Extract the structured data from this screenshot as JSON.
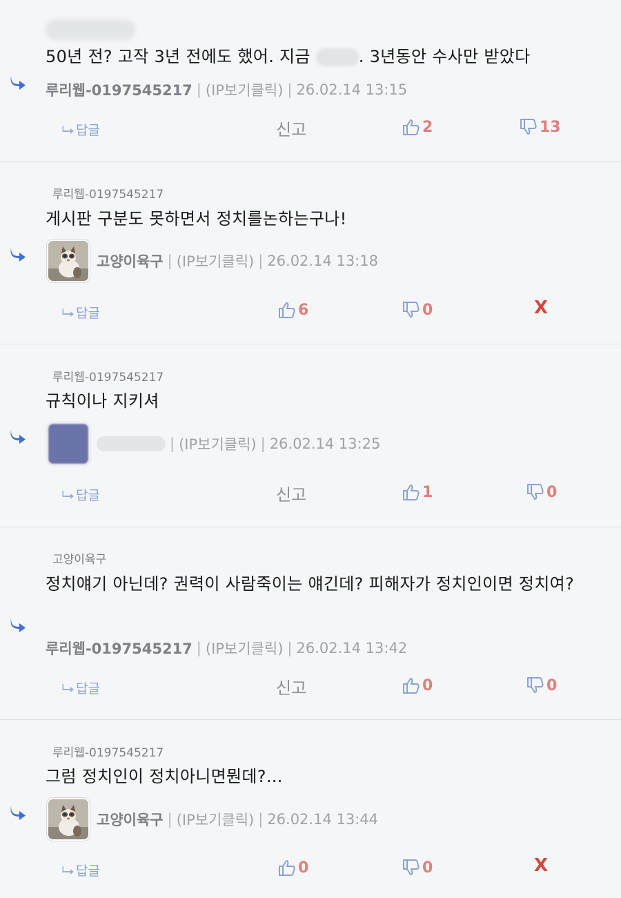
{
  "labels": {
    "reply": "답글",
    "report": "신고",
    "ip": "(IP보기클릭)",
    "x": "X"
  },
  "comments": [
    {
      "ref": "",
      "text": "50년 전? 고작 3년 전에도 했어. 지금 ",
      "text_after": ". 3년동안 수사만 받았다",
      "nick": "루리웹-0197545217",
      "date": "26.02.14 13:15",
      "up": "2",
      "down": "13",
      "action": "report"
    },
    {
      "ref": "루리웹-0197545217",
      "text": "게시판 구분도 못하면서 정치를논하는구나!",
      "nick": "고양이육구",
      "date": "26.02.14 13:18",
      "up": "6",
      "down": "0",
      "action": "delete"
    },
    {
      "ref": "루리웹-0197545217",
      "text": "규칙이나 지키셔",
      "nick": "",
      "date": "26.02.14 13:25",
      "up": "1",
      "down": "0",
      "action": "report"
    },
    {
      "ref": "고양이육구",
      "text": "정치얘기 아닌데? 권력이 사람죽이는 얘긴데? 피해자가 정치인이면 정치여?",
      "nick": "루리웹-0197545217",
      "date": "26.02.14 13:42",
      "up": "0",
      "down": "0",
      "action": "report"
    },
    {
      "ref": "루리웹-0197545217",
      "text": "그럼 정치인이 정치아니면뭔데?...",
      "nick": "고양이육구",
      "date": "26.02.14 13:44",
      "up": "0",
      "down": "0",
      "action": "delete"
    }
  ],
  "colors": {
    "reply_arrow": "#3f6fd1",
    "vote_icon": "#8aa3cf",
    "vote_count": "#e0807c",
    "delete_x": "#d44a40"
  }
}
